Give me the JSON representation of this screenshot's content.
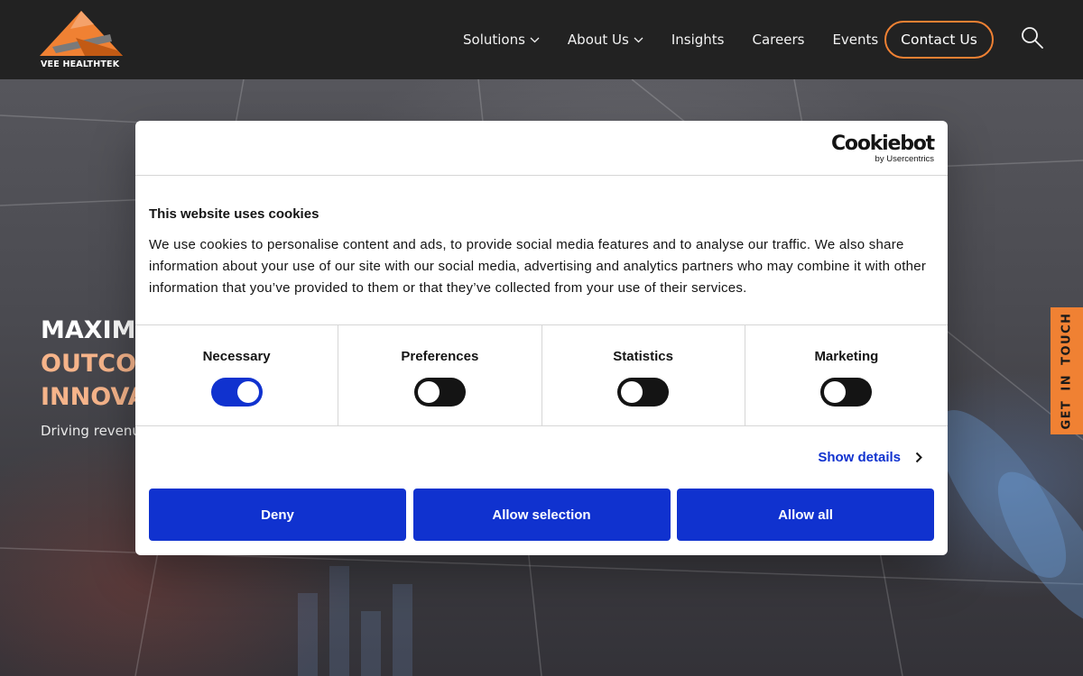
{
  "header": {
    "logo_text": "VEE HEALTHTEK",
    "nav": [
      {
        "label": "Solutions",
        "has_dropdown": true
      },
      {
        "label": "About Us",
        "has_dropdown": true
      },
      {
        "label": "Insights",
        "has_dropdown": false
      },
      {
        "label": "Careers",
        "has_dropdown": false
      },
      {
        "label": "Events",
        "has_dropdown": false
      }
    ],
    "contact_label": "Contact Us",
    "search_icon": "search-icon"
  },
  "hero": {
    "title_line1": "MAXIMIZ",
    "title_line2": "OUTCOM",
    "title_line3": "INNOVA",
    "subtitle": "Driving revenu"
  },
  "side_tab": {
    "label": "GET IN TOUCH"
  },
  "cookie_dialog": {
    "brand": "Cookiebot",
    "brand_sub": "by Usercentrics",
    "title": "This website uses cookies",
    "text": "We use cookies to personalise content and ads, to provide social media features and to analyse our traffic. We also share information about your use of our site with our social media, advertising and analytics partners who may combine it with other information that you’ve provided to them or that they’ve collected from your use of their services.",
    "toggles": [
      {
        "label": "Necessary",
        "on": true
      },
      {
        "label": "Preferences",
        "on": false
      },
      {
        "label": "Statistics",
        "on": false
      },
      {
        "label": "Marketing",
        "on": false
      }
    ],
    "show_details": "Show details",
    "buttons": {
      "deny": "Deny",
      "allow_selection": "Allow selection",
      "allow_all": "Allow all"
    }
  },
  "colors": {
    "accent_orange": "#f08133",
    "cookie_blue": "#1032cf",
    "header_bg": "#222222"
  }
}
